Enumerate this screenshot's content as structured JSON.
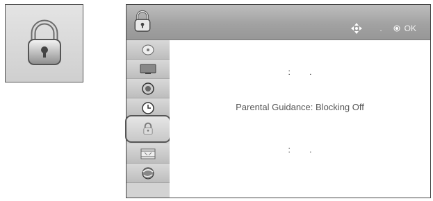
{
  "hint": {
    "move_dot": ".",
    "ok_label": "OK"
  },
  "sidebar": {
    "items": [
      {
        "icon": "disc-icon"
      },
      {
        "icon": "tv-screen-icon"
      },
      {
        "icon": "speaker-icon"
      },
      {
        "icon": "clock-icon"
      },
      {
        "icon": "lock-icon",
        "selected": true
      },
      {
        "icon": "film-icon"
      },
      {
        "icon": "network-globe-icon"
      }
    ]
  },
  "content": {
    "rows": [
      {
        "colon": ":",
        "dot": "."
      },
      {
        "colon": ":",
        "dot": "."
      }
    ],
    "parental_guidance": "Parental Guidance: Blocking Off"
  },
  "colors": {
    "topbar": "#a8a8a8",
    "sidebar": "#d3d3d3",
    "text": "#444444"
  }
}
